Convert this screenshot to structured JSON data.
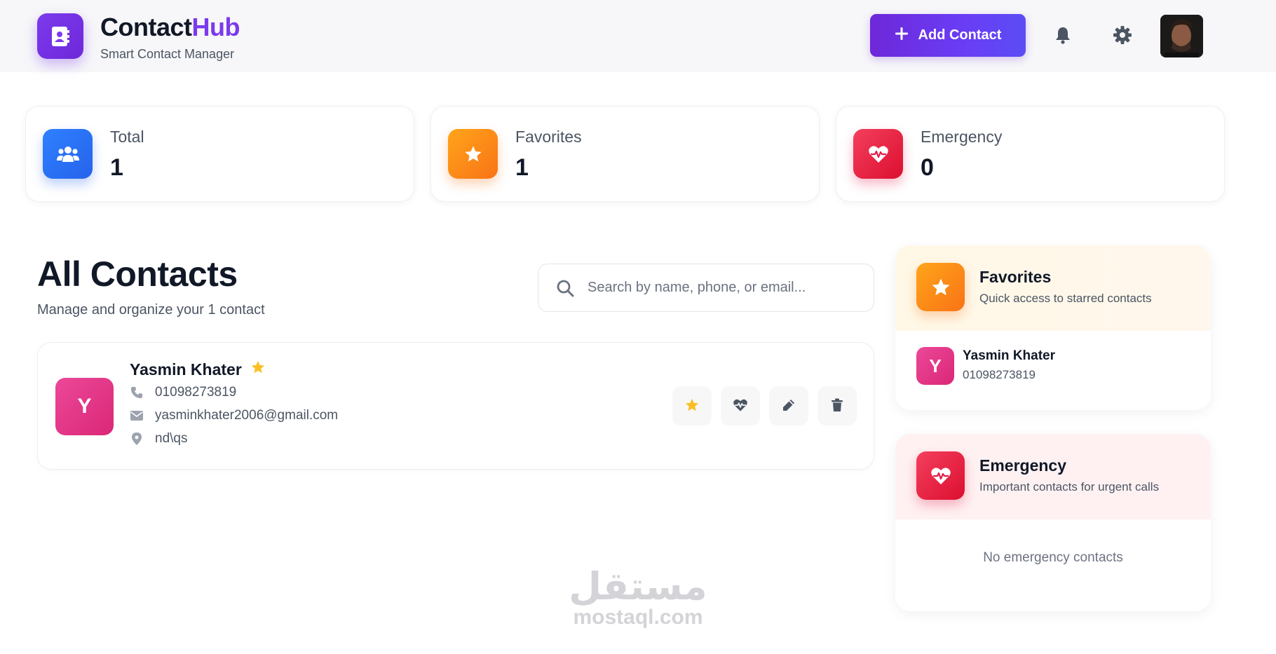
{
  "header": {
    "brand_part1": "Contact",
    "brand_part2": "Hub",
    "tagline": "Smart Contact Manager",
    "add_button_label": "Add Contact",
    "icons": [
      "address-book-icon",
      "plus-icon",
      "bell-icon",
      "gear-icon"
    ]
  },
  "stats": [
    {
      "label": "Total",
      "value": "1",
      "icon": "users-icon",
      "color": "#2563eb"
    },
    {
      "label": "Favorites",
      "value": "1",
      "icon": "star-icon",
      "color": "#f59e0b"
    },
    {
      "label": "Emergency",
      "value": "0",
      "icon": "heart-pulse-icon",
      "color": "#e11d48"
    }
  ],
  "main": {
    "title": "All Contacts",
    "subtitle": "Manage and organize your 1 contact",
    "search_placeholder": "Search by name, phone, or email..."
  },
  "contacts": [
    {
      "initial": "Y",
      "name": "Yasmin Khater",
      "favorite": true,
      "phone": "01098273819",
      "email": "yasminkhater2006@gmail.com",
      "address": "nd\\qs",
      "avatar_color": "#e83e8c"
    }
  ],
  "favorites_panel": {
    "title": "Favorites",
    "subtitle": "Quick access to starred contacts",
    "items": [
      {
        "initial": "Y",
        "name": "Yasmin Khater",
        "phone": "01098273819"
      }
    ]
  },
  "emergency_panel": {
    "title": "Emergency",
    "subtitle": "Important contacts for urgent calls",
    "empty_text": "No emergency contacts"
  },
  "watermark": {
    "arabic": "مستقل",
    "latin": "mostaql.com"
  },
  "colors": {
    "accent": "#7c3aed",
    "star": "#fbbf24",
    "favorites_header_bg": "#fff8eb",
    "emergency_header_bg": "#fff1f2"
  }
}
